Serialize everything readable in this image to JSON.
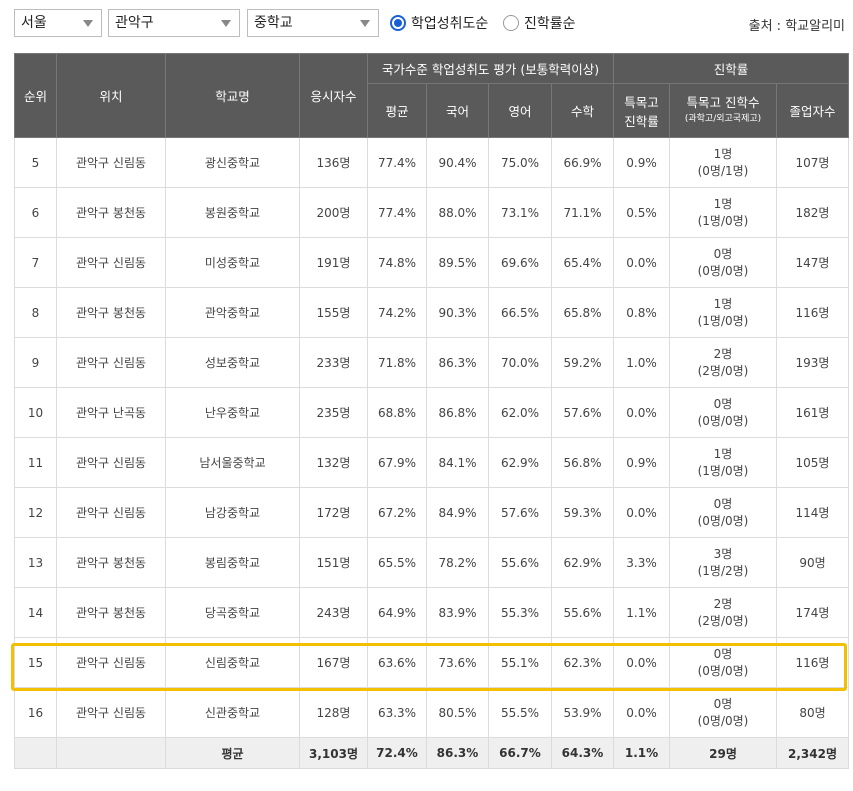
{
  "filters": {
    "region": "서울",
    "district": "관악구",
    "school_level": "중학교"
  },
  "sort_options": [
    {
      "label": "학업성취도순",
      "selected": true
    },
    {
      "label": "진학률순",
      "selected": false
    }
  ],
  "source": "출처 : 학교알리미",
  "headers": {
    "rank": "순위",
    "location": "위치",
    "school": "학교명",
    "test_takers": "응시자수",
    "national_group": "국가수준 학업성취도 평가 (보통학력이상)",
    "avg": "평균",
    "korean": "국어",
    "english": "영어",
    "math": "수학",
    "advancement_group": "진학률",
    "special_rate": "특목고 진학률",
    "special_count": "특목고 진학수",
    "special_count_sub": "(과학고/외고국제고)",
    "graduates": "졸업자수"
  },
  "rows": [
    {
      "rank": "5",
      "loc": "관악구 신림동",
      "school": "광신중학교",
      "takers": "136명",
      "avg": "77.4%",
      "kor": "90.4%",
      "eng": "75.0%",
      "math": "66.9%",
      "srate": "0.9%",
      "scount": "1명",
      "ssplit": "(0명/1명)",
      "grads": "107명"
    },
    {
      "rank": "6",
      "loc": "관악구 봉천동",
      "school": "봉원중학교",
      "takers": "200명",
      "avg": "77.4%",
      "kor": "88.0%",
      "eng": "73.1%",
      "math": "71.1%",
      "srate": "0.5%",
      "scount": "1명",
      "ssplit": "(1명/0명)",
      "grads": "182명"
    },
    {
      "rank": "7",
      "loc": "관악구 신림동",
      "school": "미성중학교",
      "takers": "191명",
      "avg": "74.8%",
      "kor": "89.5%",
      "eng": "69.6%",
      "math": "65.4%",
      "srate": "0.0%",
      "scount": "0명",
      "ssplit": "(0명/0명)",
      "grads": "147명"
    },
    {
      "rank": "8",
      "loc": "관악구 봉천동",
      "school": "관악중학교",
      "takers": "155명",
      "avg": "74.2%",
      "kor": "90.3%",
      "eng": "66.5%",
      "math": "65.8%",
      "srate": "0.8%",
      "scount": "1명",
      "ssplit": "(1명/0명)",
      "grads": "116명"
    },
    {
      "rank": "9",
      "loc": "관악구 신림동",
      "school": "성보중학교",
      "takers": "233명",
      "avg": "71.8%",
      "kor": "86.3%",
      "eng": "70.0%",
      "math": "59.2%",
      "srate": "1.0%",
      "scount": "2명",
      "ssplit": "(2명/0명)",
      "grads": "193명"
    },
    {
      "rank": "10",
      "loc": "관악구 난곡동",
      "school": "난우중학교",
      "takers": "235명",
      "avg": "68.8%",
      "kor": "86.8%",
      "eng": "62.0%",
      "math": "57.6%",
      "srate": "0.0%",
      "scount": "0명",
      "ssplit": "(0명/0명)",
      "grads": "161명"
    },
    {
      "rank": "11",
      "loc": "관악구 신림동",
      "school": "남서울중학교",
      "takers": "132명",
      "avg": "67.9%",
      "kor": "84.1%",
      "eng": "62.9%",
      "math": "56.8%",
      "srate": "0.9%",
      "scount": "1명",
      "ssplit": "(1명/0명)",
      "grads": "105명"
    },
    {
      "rank": "12",
      "loc": "관악구 신림동",
      "school": "남강중학교",
      "takers": "172명",
      "avg": "67.2%",
      "kor": "84.9%",
      "eng": "57.6%",
      "math": "59.3%",
      "srate": "0.0%",
      "scount": "0명",
      "ssplit": "(0명/0명)",
      "grads": "114명"
    },
    {
      "rank": "13",
      "loc": "관악구 봉천동",
      "school": "봉림중학교",
      "takers": "151명",
      "avg": "65.5%",
      "kor": "78.2%",
      "eng": "55.6%",
      "math": "62.9%",
      "srate": "3.3%",
      "scount": "3명",
      "ssplit": "(1명/2명)",
      "grads": "90명"
    },
    {
      "rank": "14",
      "loc": "관악구 봉천동",
      "school": "당곡중학교",
      "takers": "243명",
      "avg": "64.9%",
      "kor": "83.9%",
      "eng": "55.3%",
      "math": "55.6%",
      "srate": "1.1%",
      "scount": "2명",
      "ssplit": "(2명/0명)",
      "grads": "174명"
    },
    {
      "rank": "15",
      "loc": "관악구 신림동",
      "school": "신림중학교",
      "takers": "167명",
      "avg": "63.6%",
      "kor": "73.6%",
      "eng": "55.1%",
      "math": "62.3%",
      "srate": "0.0%",
      "scount": "0명",
      "ssplit": "(0명/0명)",
      "grads": "116명"
    },
    {
      "rank": "16",
      "loc": "관악구 신림동",
      "school": "신관중학교",
      "takers": "128명",
      "avg": "63.3%",
      "kor": "80.5%",
      "eng": "55.5%",
      "math": "53.9%",
      "srate": "0.0%",
      "scount": "0명",
      "ssplit": "(0명/0명)",
      "grads": "80명"
    }
  ],
  "average_row": {
    "label": "평균",
    "takers": "3,103명",
    "avg": "72.4%",
    "kor": "86.3%",
    "eng": "66.7%",
    "math": "64.3%",
    "srate": "1.1%",
    "scount": "29명",
    "grads": "2,342명"
  },
  "highlight_color": "#f2c000",
  "accent_color": "#1a5fd6",
  "header_bg": "#5a5a5a"
}
